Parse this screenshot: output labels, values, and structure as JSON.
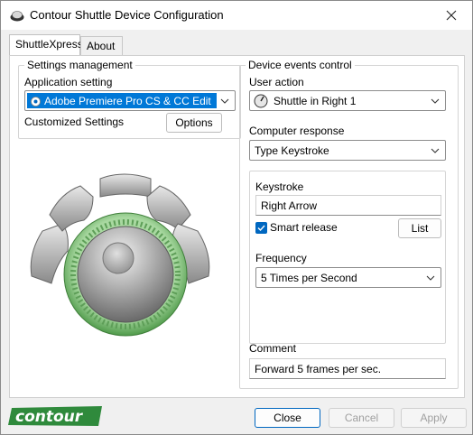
{
  "window": {
    "title": "Contour Shuttle Device Configuration"
  },
  "tabs": [
    {
      "label": "ShuttleXpress",
      "active": true
    },
    {
      "label": "About",
      "active": false
    }
  ],
  "settings_management": {
    "title": "Settings management",
    "application_label": "Application setting",
    "application_value": "Adobe Premiere Pro CS & CC Edit",
    "customized_label": "Customized Settings",
    "options_button": "Options"
  },
  "device_events": {
    "title": "Device events control",
    "user_action_label": "User action",
    "user_action_value": "Shuttle in Right 1",
    "computer_response_label": "Computer response",
    "computer_response_value": "Type Keystroke",
    "keystroke_label": "Keystroke",
    "keystroke_value": "Right Arrow",
    "smart_release_label": "Smart release",
    "smart_release_checked": true,
    "list_button": "List",
    "frequency_label": "Frequency",
    "frequency_value": "5 Times per Second",
    "comment_label": "Comment",
    "comment_value": "Forward 5 frames per sec."
  },
  "footer": {
    "logo_text": "contour",
    "close_button": "Close",
    "cancel_button": "Cancel",
    "apply_button": "Apply"
  },
  "colors": {
    "accent": "#0078d7",
    "ring_green": "#7fbf7a",
    "logo_green": "#2f8a3c"
  }
}
